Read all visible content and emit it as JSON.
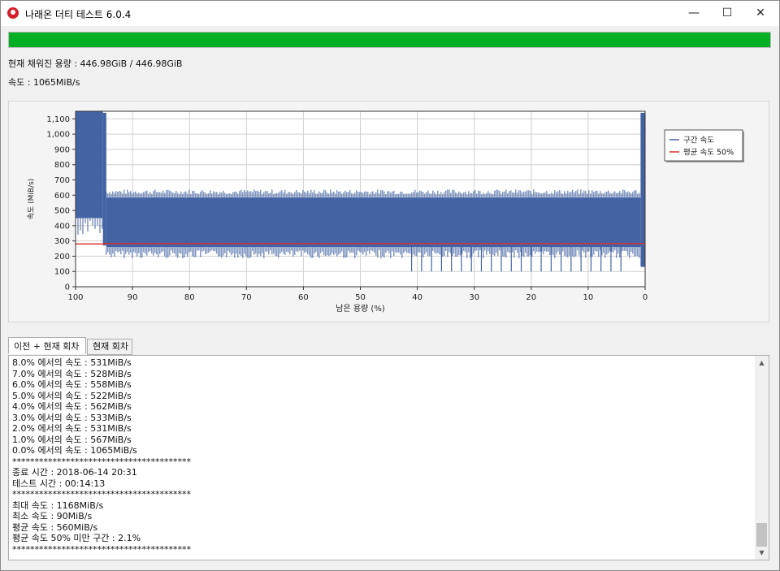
{
  "window": {
    "title": "나래온 더티 테스트 6.0.4",
    "minimize_glyph": "—",
    "maximize_glyph": "☐",
    "close_glyph": "✕"
  },
  "progress": {
    "fraction": 1.0,
    "color": "#06b025"
  },
  "status": {
    "filled_capacity": "현재 채워진 용량 : 446.98GiB / 446.98GiB",
    "speed": "속도 : 1065MiB/s"
  },
  "chart_data": {
    "type": "area",
    "xlabel": "남은 용량 (%)",
    "ylabel": "속도 (MiB/s)",
    "xlim": [
      100,
      0
    ],
    "ylim": [
      0,
      1150
    ],
    "x_ticks": [
      100,
      90,
      80,
      70,
      60,
      50,
      40,
      30,
      20,
      10,
      0
    ],
    "y_ticks": [
      0,
      100,
      200,
      300,
      400,
      500,
      600,
      700,
      800,
      900,
      1000,
      1100
    ],
    "y_tick_labels": [
      "0",
      "100",
      "200",
      "300",
      "400",
      "500",
      "600",
      "700",
      "800",
      "900",
      "1,000",
      "1,100"
    ],
    "grid": true,
    "legend_position": "top-right",
    "series": [
      {
        "name": "구간 속도",
        "color": "#4463a3",
        "band": [
          {
            "x_from": 100,
            "x_to": 95.2,
            "low": 450,
            "high": 1150
          },
          {
            "x_from": 95.2,
            "x_to": 94.6,
            "low": 270,
            "high": 1140
          },
          {
            "x_from": 94.6,
            "x_to": 0.8,
            "low": 260,
            "high": 585
          },
          {
            "x_from": 0.8,
            "x_to": 0,
            "low": 130,
            "high": 1140
          }
        ]
      },
      {
        "name": "평균 속도 50%",
        "color": "#d93030",
        "values": [
          {
            "x": 100,
            "y": 280
          },
          {
            "x": 95,
            "y": 280
          },
          {
            "x": 95,
            "y": 283
          },
          {
            "x": 0,
            "y": 283
          }
        ]
      }
    ]
  },
  "tabs": [
    {
      "label": "이전 + 현재 회차",
      "active": true
    },
    {
      "label": "현재 회차",
      "active": false
    }
  ],
  "log": {
    "lines": [
      "8.0% 에서의 속도 : 531MiB/s",
      "7.0% 에서의 속도 : 528MiB/s",
      "6.0% 에서의 속도 : 558MiB/s",
      "5.0% 에서의 속도 : 522MiB/s",
      "4.0% 에서의 속도 : 562MiB/s",
      "3.0% 에서의 속도 : 533MiB/s",
      "2.0% 에서의 속도 : 531MiB/s",
      "1.0% 에서의 속도 : 567MiB/s",
      "0.0% 에서의 속도 : 1065MiB/s",
      "****************************************",
      "종료 시간 : 2018-06-14 20:31",
      "테스트 시간 : 00:14:13",
      "****************************************",
      "최대 속도 : 1168MiB/s",
      "최소 속도 : 90MiB/s",
      "평균 속도 : 560MiB/s",
      "평균 속도 50% 미만 구간 : 2.1%",
      "****************************************"
    ],
    "scroll_up_glyph": "▲",
    "scroll_down_glyph": "▼"
  }
}
